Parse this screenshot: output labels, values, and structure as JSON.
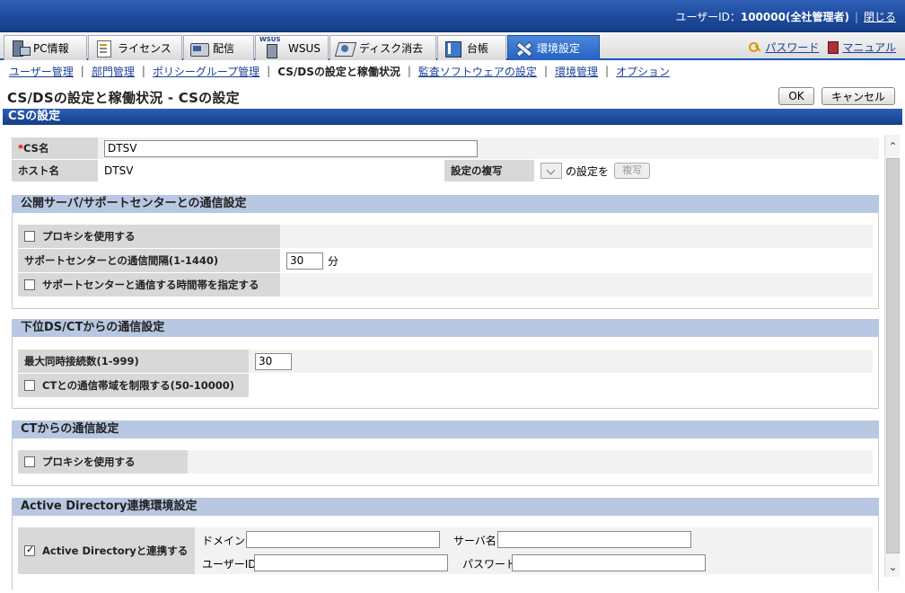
{
  "header": {
    "user_label": "ユーザーID：",
    "user_id": "100000(全社管理者)",
    "logout": "閉じる"
  },
  "tabs": [
    {
      "label": "PC情報",
      "icon": "pc-icon"
    },
    {
      "label": "ライセンス",
      "icon": "license-icon"
    },
    {
      "label": "配信",
      "icon": "distribution-icon"
    },
    {
      "label": "WSUS",
      "icon": "wsus-icon"
    },
    {
      "label": "ディスク消去",
      "icon": "disk-erase-icon"
    },
    {
      "label": "台帳",
      "icon": "ledger-icon"
    },
    {
      "label": "環境設定",
      "icon": "settings-icon",
      "active": true
    }
  ],
  "toplinks": {
    "password": "パスワード",
    "manual": "マニュアル"
  },
  "subnav": {
    "items": [
      "ユーザー管理",
      "部門管理",
      "ポリシーグループ管理",
      "CS/DSの設定と稼働状況",
      "監査ソフトウェアの設定",
      "環境管理",
      "オプション"
    ],
    "current_index": 3
  },
  "page": {
    "title": "CS/DSの設定と稼働状況 - CSの設定",
    "ok": "OK",
    "cancel": "キャンセル",
    "section": "CSの設定"
  },
  "basic": {
    "cs_name_label": "CS名",
    "cs_name_required": "*",
    "cs_name_value": "DTSV",
    "host_label": "ホスト名",
    "host_value": "DTSV",
    "copy_label": "設定の複写",
    "copy_suffix": "の設定を",
    "copy_button": "複写"
  },
  "public_server": {
    "title": "公開サーバ/サポートセンターとの通信設定",
    "use_proxy": "プロキシを使用する",
    "interval_label": "サポートセンターとの通信間隔(1-1440)",
    "interval_value": "30",
    "interval_unit": "分",
    "time_window": "サポートセンターと通信する時間帯を指定する"
  },
  "downstream": {
    "title": "下位DS/CTからの通信設定",
    "max_conn_label": "最大同時接続数(1-999)",
    "max_conn_value": "30",
    "limit_bandwidth": "CTとの通信帯域を制限する(50-10000)"
  },
  "ct_comm": {
    "title": "CTからの通信設定",
    "use_proxy": "プロキシを使用する"
  },
  "ad": {
    "title": "Active Directory連携環境設定",
    "link_label": "Active Directoryと連携する",
    "link_checked": true,
    "domain_label": "ドメイン名",
    "server_label": "サーバ名",
    "userid_label": "ユーザーID",
    "password_label": "パスワード"
  }
}
